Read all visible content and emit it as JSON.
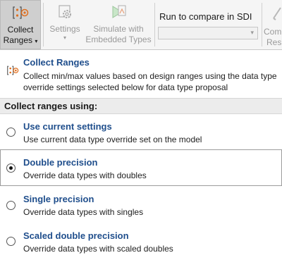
{
  "toolbar": {
    "collect_label_1": "Collect",
    "collect_label_2": "Ranges",
    "collect_caret": "▾",
    "settings_label": "Settings",
    "settings_caret": "▾",
    "simulate_label_1": "Simulate with",
    "simulate_label_2": "Embedded Types",
    "run_compare_label": "Run to compare in SDI",
    "run_select_value": "",
    "run_select_arrow": "▾",
    "compare_label_1": "Com",
    "compare_label_2": "Resu"
  },
  "header": {
    "title": "Collect Ranges",
    "description": "Collect min/max values based on design ranges using the data type override settings selected below for data type proposal"
  },
  "section": {
    "title": "Collect ranges using:"
  },
  "options": [
    {
      "title": "Use current settings",
      "desc": "Use current data type override set on the model",
      "checked": false
    },
    {
      "title": "Double precision",
      "desc": "Override data types with doubles",
      "checked": true
    },
    {
      "title": "Single precision",
      "desc": "Override data types with singles",
      "checked": false
    },
    {
      "title": "Scaled double precision",
      "desc": "Override data types with scaled doubles",
      "checked": false
    }
  ],
  "colors": {
    "link_blue": "#1f4e8c",
    "toolbar_bg": "#f5f5f5",
    "selected_button_bg": "#cfcfcf",
    "icon_orange": "#e07020"
  },
  "icons": {
    "collect": "collect-ranges-icon",
    "settings": "settings-gear-icon",
    "simulate": "simulate-embedded-icon",
    "compare": "compare-results-icon"
  }
}
